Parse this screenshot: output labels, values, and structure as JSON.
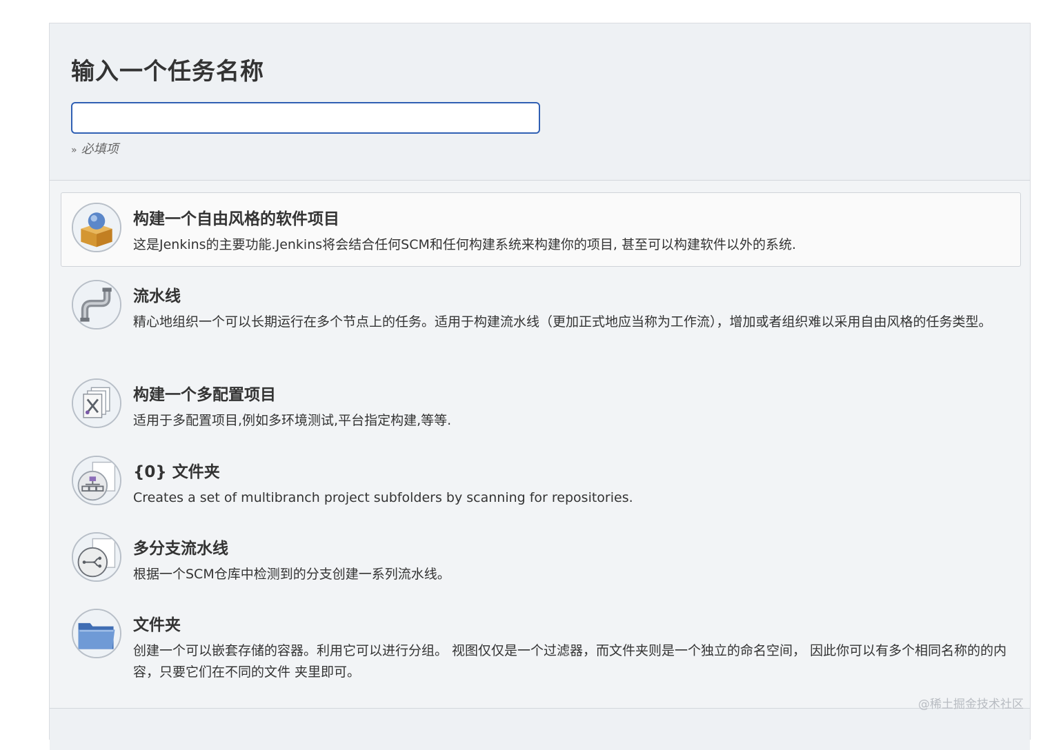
{
  "form": {
    "title": "输入一个任务名称",
    "name_input_value": "",
    "required_chevron": "»",
    "required_note": "必填项"
  },
  "job_types": [
    {
      "label": "构建一个自由风格的软件项目",
      "description": "这是Jenkins的主要功能.Jenkins将会结合任何SCM和任何构建系统来构建你的项目, 甚至可以构建软件以外的系统.",
      "icon": "freestyle-box-icon",
      "selected": true
    },
    {
      "label": "流水线",
      "description": "精心地组织一个可以长期运行在多个节点上的任务。适用于构建流水线（更加正式地应当称为工作流），增加或者组织难以采用自由风格的任务类型。",
      "icon": "pipe-icon",
      "selected": false
    },
    {
      "label": "构建一个多配置项目",
      "description": "适用于多配置项目,例如多环境测试,平台指定构建,等等.",
      "icon": "multi-config-tools-icon",
      "selected": false
    },
    {
      "label": "{0} 文件夹",
      "description": "Creates a set of multibranch project subfolders by scanning for repositories.",
      "icon": "organization-folder-icon",
      "selected": false
    },
    {
      "label": "多分支流水线",
      "description": "根据一个SCM仓库中检测到的分支创建一系列流水线。",
      "icon": "branch-icon",
      "selected": false
    },
    {
      "label": "文件夹",
      "description": "创建一个可以嵌套存储的容器。利用它可以进行分组。 视图仅仅是一个过滤器，而文件夹则是一个独立的命名空间， 因此你可以有多个相同名称的的内容，只要它们在不同的文件 夹里即可。",
      "icon": "folder-icon",
      "selected": false
    }
  ],
  "watermark": "@稀土掘金技术社区",
  "colors": {
    "input_border": "#2f5fb3",
    "panel_bg": "#f2f4f6",
    "selected_bg": "#fafafa"
  }
}
